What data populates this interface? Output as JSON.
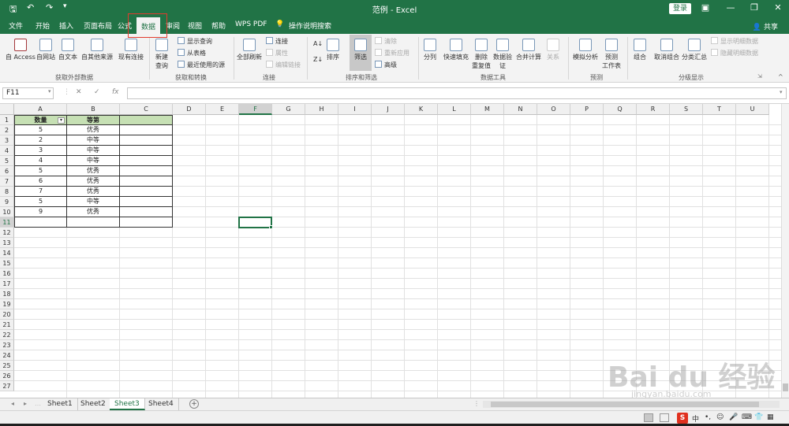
{
  "titlebar": {
    "doc_title": "范例 - Excel",
    "login_label": "登录"
  },
  "ribbon_tabs": [
    "文件",
    "开始",
    "插入",
    "页面布局",
    "公式",
    "数据",
    "审阅",
    "视图",
    "帮助",
    "WPS PDF"
  ],
  "active_tab": "数据",
  "tell_me": "操作说明搜索",
  "share_label": "共享",
  "ribbon": {
    "get_external": {
      "label": "获取外部数据",
      "access": "自 Access",
      "web": "自网站",
      "text": "自文本",
      "other": "自其他来源",
      "existing": "现有连接"
    },
    "get_transform": {
      "label": "获取和转换",
      "new_query_1": "新建",
      "new_query_2": "查询",
      "show_queries": "显示查询",
      "from_table": "从表格",
      "recent_sources": "最近使用的源"
    },
    "connections": {
      "label": "连接",
      "refresh_all": "全部刷新",
      "connections": "连接",
      "properties": "属性",
      "edit_links": "编辑链接"
    },
    "sort_filter": {
      "label": "排序和筛选",
      "sort": "排序",
      "filter": "筛选",
      "clear": "清除",
      "reapply": "重新应用",
      "advanced": "高级"
    },
    "data_tools": {
      "label": "数据工具",
      "text_to_cols": "分列",
      "flash_fill": "快速填充",
      "remove_dup_1": "删除",
      "remove_dup_2": "重复值",
      "validation_1": "数据验",
      "validation_2": "证",
      "consolidate": "合并计算",
      "relationships": "关系"
    },
    "forecast": {
      "label": "预测",
      "what_if": "模拟分析",
      "forecast_1": "预测",
      "forecast_2": "工作表"
    },
    "outline": {
      "label": "分级显示",
      "group": "组合",
      "ungroup": "取消组合",
      "subtotal": "分类汇总",
      "show_detail": "显示明细数据",
      "hide_detail": "隐藏明细数据"
    }
  },
  "formula_bar": {
    "name_box": "F11",
    "fx": "fx",
    "value": ""
  },
  "columns": [
    "A",
    "B",
    "C",
    "D",
    "E",
    "F",
    "G",
    "H",
    "I",
    "J",
    "K",
    "L",
    "M",
    "N",
    "O",
    "P",
    "Q",
    "R",
    "S",
    "T",
    "U"
  ],
  "selected_column": "F",
  "selected_row": 11,
  "row_count": 27,
  "table": {
    "headers": [
      "数量",
      "等第",
      ""
    ],
    "rows": [
      [
        "5",
        "优秀",
        ""
      ],
      [
        "2",
        "中等",
        ""
      ],
      [
        "3",
        "中等",
        ""
      ],
      [
        "4",
        "中等",
        ""
      ],
      [
        "5",
        "优秀",
        ""
      ],
      [
        "6",
        "优秀",
        ""
      ],
      [
        "7",
        "优秀",
        ""
      ],
      [
        "5",
        "中等",
        ""
      ],
      [
        "9",
        "优秀",
        ""
      ],
      [
        "",
        "",
        ""
      ]
    ]
  },
  "sheets": [
    "Sheet1",
    "Sheet2",
    "Sheet3",
    "Sheet4"
  ],
  "active_sheet": "Sheet3",
  "statusbar": {
    "ime": "S",
    "ime_mode": "中"
  },
  "watermark": {
    "brand": "Bai du 经验",
    "url": "jingyan.baidu.com"
  },
  "colors": {
    "excel_green": "#217346",
    "header_fill": "#c6e0b4",
    "highlight_red": "#e23b2e"
  }
}
